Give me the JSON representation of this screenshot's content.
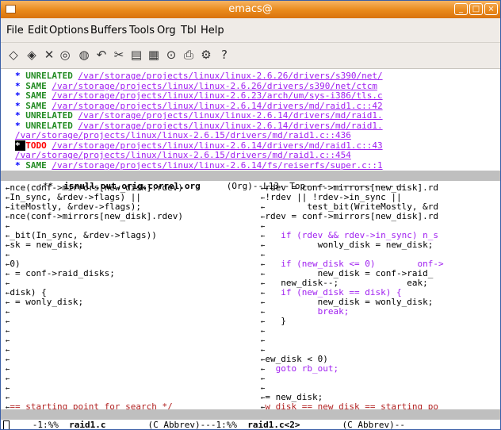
{
  "window": {
    "title": "emacs@"
  },
  "menubar": {
    "items": [
      "File",
      "Edit",
      "Options",
      "Buffers",
      "Tools",
      "Org",
      "Tbl",
      "Help"
    ]
  },
  "toolbar": {
    "icons": [
      "open-file-icon",
      "open-dir-icon",
      "close-icon",
      "save-icon",
      "save-as-icon",
      "undo-icon",
      "cut-icon",
      "copy-icon",
      "paste-icon",
      "search-icon",
      "print-icon",
      "preferences-icon",
      "help-icon"
    ]
  },
  "org": {
    "lines": [
      {
        "star": "*",
        "keyword": "UNRELATED",
        "path": "/var/storage/projects/linux/linux-2.6.26/drivers/s390/net/"
      },
      {
        "star": "*",
        "keyword": "SAME",
        "path": "/var/storage/projects/linux/linux-2.6.26/drivers/s390/net/ctcm"
      },
      {
        "star": "*",
        "keyword": "SAME",
        "path": "/var/storage/projects/linux/linux-2.6.23/arch/um/sys-i386/tls.c"
      },
      {
        "star": "*",
        "keyword": "SAME",
        "path": "/var/storage/projects/linux/linux-2.6.14/drivers/md/raid1.c::42"
      },
      {
        "star": "*",
        "keyword": "UNRELATED",
        "path": "/var/storage/projects/linux/linux-2.6.14/drivers/md/raid1."
      },
      {
        "star": "*",
        "keyword": "UNRELATED",
        "path": "/var/storage/projects/linux/linux-2.6.14/drivers/md/raid1."
      },
      {
        "star": "",
        "keyword": "",
        "path": "/var/storage/projects/linux/linux-2.6.15/drivers/md/raid1.c::436"
      },
      {
        "star": "*",
        "keyword": "TODO",
        "path": "/var/storage/projects/linux/linux-2.6.14/drivers/md/raid1.c::43"
      },
      {
        "star": "",
        "keyword": "",
        "path": "/var/storage/projects/linux/linux-2.6.15/drivers/md/raid1.c::454"
      },
      {
        "star": "*",
        "keyword": "SAME",
        "path": "/var/storage/projects/linux/linux-2.6.14/fs/reiserfs/super.c::1"
      }
    ],
    "modeline": {
      "prefix": "-:**  ",
      "buffer": "isnull.out.orig.correl.org",
      "suffix": "     (Org)--L13--Top-------------------"
    }
  },
  "left_pane": {
    "lines": [
      "nce(conf->mirrors[new_disk].rdev)",
      "In_sync, &rdev->flags) ||",
      "iteMostly, &rdev->flags);",
      "nce(conf->mirrors[new_disk].rdev)",
      "",
      "_bit(In_sync, &rdev->flags))",
      "sk = new_disk;",
      "",
      "0)",
      " = conf->raid_disks;",
      "",
      "disk) {",
      " = wonly_disk;",
      "",
      "",
      "",
      "",
      "",
      "",
      "",
      "",
      "",
      "",
      "== starting point for search */"
    ],
    "modeline": {
      "prefix": "-1:%%  ",
      "buffer": "raid1.c",
      "suffix": "        (C Abbrev)---"
    }
  },
  "right_pane": {
    "lines": [
      "rdev = conf->mirrors[new_disk].rd",
      "!rdev || !rdev->in_sync ||",
      "        test_bit(WriteMostly, &rd",
      "rdev = conf->mirrors[new_disk].rd",
      "",
      "   if (rdev && rdev->in_sync) n_s",
      "          wonly_disk = new_disk;",
      "",
      "   if (new_disk <= 0)        onf->",
      "          new_disk = conf->raid_",
      "   new_disk--;             eak;",
      "   if (new_disk == disk) {",
      "          new_disk = wonly_disk;",
      "          break;",
      "   }",
      "",
      "",
      "",
      "ew_disk < 0)",
      "  goto rb_out;",
      "",
      "",
      "= new_disk;",
      "w disk == new_disk == starting po"
    ],
    "modeline": {
      "prefix": "1:%%  ",
      "buffer": "raid1.c<2>",
      "suffix": "        (C Abbrev)--"
    }
  },
  "colors": {
    "title_bar": "#e9891b",
    "menu_bg": "#efebe7",
    "modeline_bg": "#bfbfbf",
    "link": "#a020f0",
    "keyword_ok": "#228b22",
    "todo": "#ff0000"
  }
}
